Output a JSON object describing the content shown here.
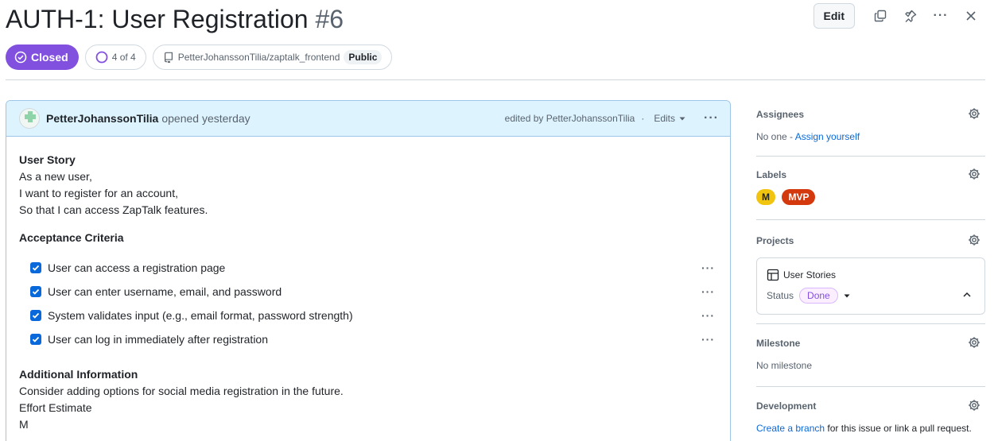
{
  "issue": {
    "title": "AUTH-1: User Registration",
    "number": "#6",
    "state": "Closed",
    "tasks_progress": "4 of 4",
    "repo": "PetterJohanssonTilia/zaptalk_frontend",
    "visibility": "Public"
  },
  "header_actions": {
    "edit_label": "Edit"
  },
  "comment": {
    "author": "PetterJohanssonTilia",
    "opened_text": "opened yesterday",
    "edited_by": "edited by PetterJohanssonTilia",
    "separator": "·",
    "edits_label": "Edits",
    "user_story_heading": "User Story",
    "user_story_lines": [
      "As a new user,",
      "I want to register for an account,",
      "So that I can access ZapTalk features."
    ],
    "criteria_heading": "Acceptance Criteria",
    "tasks": [
      {
        "label": "User can access a registration page",
        "checked": true
      },
      {
        "label": "User can enter username, email, and password",
        "checked": true
      },
      {
        "label": "System validates input (e.g., email format, password strength)",
        "checked": true
      },
      {
        "label": "User can log in immediately after registration",
        "checked": true
      }
    ],
    "additional_heading": "Additional Information",
    "additional_lines": [
      "Consider adding options for social media registration in the future.",
      "Effort Estimate",
      "M"
    ]
  },
  "sidebar": {
    "assignees": {
      "title": "Assignees",
      "none_text": "No one -",
      "assign_link": "Assign yourself"
    },
    "labels": {
      "title": "Labels",
      "items": [
        {
          "name": "M",
          "color": "#f1c40f"
        },
        {
          "name": "MVP",
          "color": "#d4380d"
        }
      ]
    },
    "projects": {
      "title": "Projects",
      "project_name": "User Stories",
      "status_label": "Status",
      "status_value": "Done"
    },
    "milestone": {
      "title": "Milestone",
      "value": "No milestone"
    },
    "development": {
      "title": "Development",
      "link": "Create a branch",
      "text": "for this issue or link a pull request."
    }
  },
  "colors": {
    "accent": "#8250df",
    "link": "#0969da",
    "comment_header": "#ddf4ff"
  }
}
